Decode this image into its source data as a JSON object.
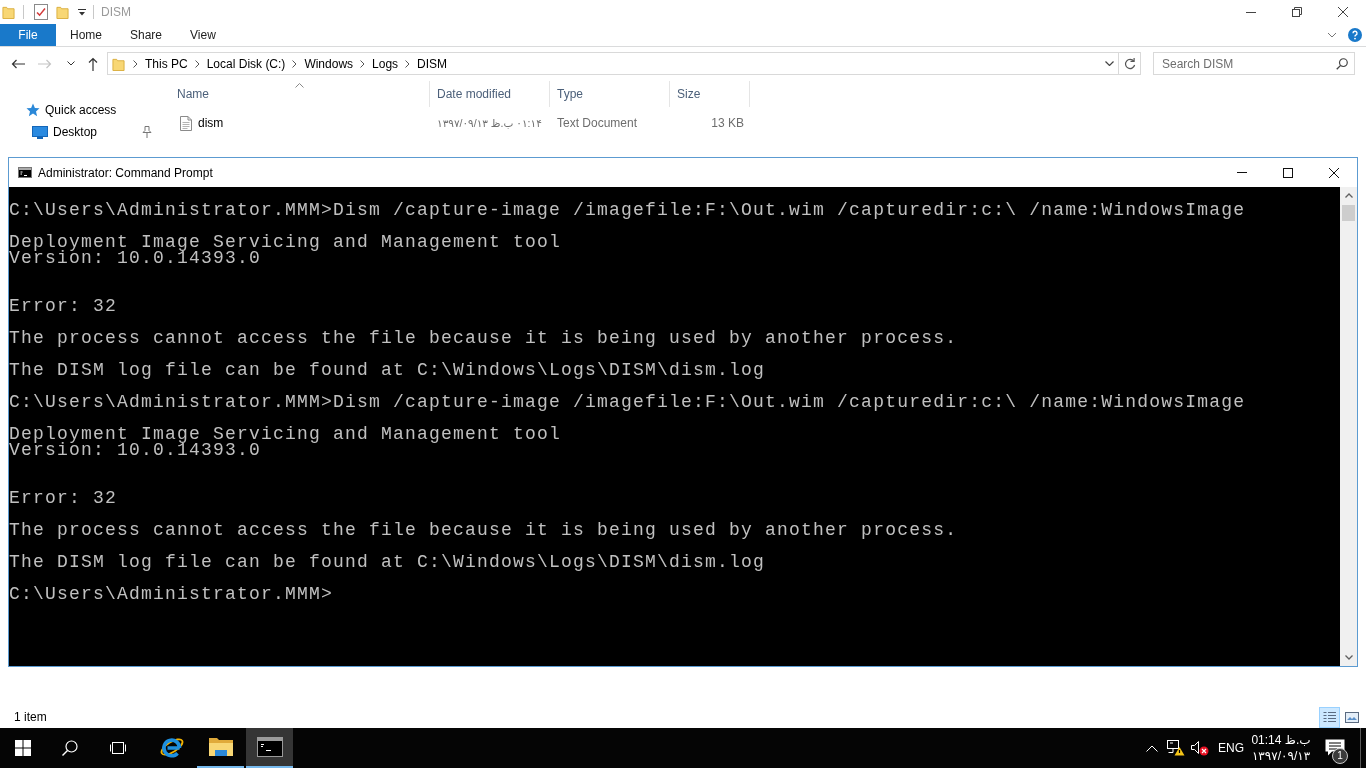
{
  "explorer": {
    "title": "DISM",
    "ribbon_tabs": [
      {
        "label": "File",
        "kind": "file_menu"
      },
      {
        "label": "Home",
        "kind": "tab"
      },
      {
        "label": "Share",
        "kind": "tab"
      },
      {
        "label": "View",
        "kind": "tab"
      }
    ],
    "nav_buttons": [
      {
        "kind": "back",
        "disabled": false
      },
      {
        "kind": "forward",
        "disabled": true
      },
      {
        "kind": "recent",
        "disabled": false
      },
      {
        "kind": "up",
        "disabled": false
      }
    ],
    "address": {
      "breadcrumbs": [
        "This PC",
        "Local Disk (C:)",
        "Windows",
        "Logs",
        "DISM"
      ]
    },
    "search": {
      "placeholder": "Search DISM"
    },
    "nav_pane": {
      "items": [
        {
          "label": "Quick access",
          "kind": "quick_access",
          "children": [
            {
              "label": "Desktop",
              "kind": "desktop",
              "pinned": true
            }
          ]
        }
      ]
    },
    "columns": [
      {
        "label": "Name",
        "sorted": true
      },
      {
        "label": "Date modified",
        "sorted": false
      },
      {
        "label": "Type",
        "sorted": false
      },
      {
        "label": "Size",
        "sorted": false
      }
    ],
    "rows": [
      {
        "name": "dism",
        "date_modified": "۰۱:۱۴ ب.ظ ۱۳۹۷/۰۹/۱۳",
        "type": "Text Document",
        "size": "13 KB"
      }
    ],
    "status_bar": {
      "item_count": "1 item"
    },
    "view_buttons": [
      {
        "kind": "details",
        "selected": true
      },
      {
        "kind": "large_icons",
        "selected": false
      }
    ]
  },
  "console_window": {
    "title": "Administrator: Command Prompt",
    "blocks": [
      {
        "kind": "command",
        "lines": [
          "C:\\Users\\Administrator.MMM>Dism /capture-image /imagefile:F:\\Out.wim /capturedir:c:\\ /name:WindowsImage"
        ]
      },
      {
        "kind": "banner",
        "lines": [
          "Deployment Image Servicing and Management tool",
          "Version: 10.0.14393.0"
        ]
      },
      {
        "kind": "error",
        "lines": [
          "Error: 32"
        ]
      },
      {
        "kind": "message",
        "lines": [
          "The process cannot access the file because it is being used by another process."
        ]
      },
      {
        "kind": "message",
        "lines": [
          "The DISM log file can be found at C:\\Windows\\Logs\\DISM\\dism.log"
        ]
      },
      {
        "kind": "command",
        "lines": [
          "C:\\Users\\Administrator.MMM>Dism /capture-image /imagefile:F:\\Out.wim /capturedir:c:\\ /name:WindowsImage"
        ]
      },
      {
        "kind": "banner",
        "lines": [
          "Deployment Image Servicing and Management tool",
          "Version: 10.0.14393.0"
        ]
      },
      {
        "kind": "error",
        "lines": [
          "Error: 32"
        ]
      },
      {
        "kind": "message",
        "lines": [
          "The process cannot access the file because it is being used by another process."
        ]
      },
      {
        "kind": "message",
        "lines": [
          "The DISM log file can be found at C:\\Windows\\Logs\\DISM\\dism.log"
        ]
      },
      {
        "kind": "prompt",
        "lines": [
          "C:\\Users\\Administrator.MMM>"
        ]
      }
    ]
  },
  "taskbar": {
    "apps": [
      {
        "kind": "internet_explorer",
        "running": false,
        "active": false
      },
      {
        "kind": "file_explorer",
        "running": true,
        "active": false
      },
      {
        "kind": "command_prompt",
        "running": true,
        "active": true
      }
    ],
    "tray": {
      "language": "ENG",
      "time": "01:14 ب.ظ",
      "date": "۱۳۹۷/۰۹/۱۳",
      "notification_count": "1"
    }
  }
}
